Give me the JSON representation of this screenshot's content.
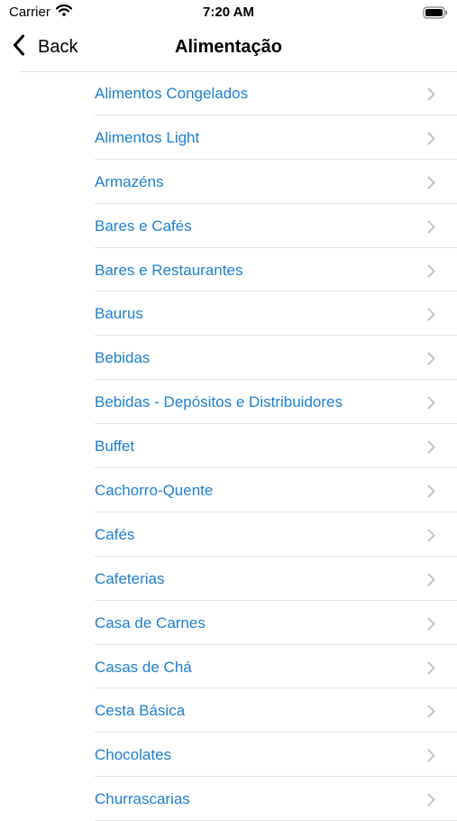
{
  "status": {
    "carrier": "Carrier",
    "time": "7:20 AM"
  },
  "nav": {
    "back_label": "Back",
    "title": "Alimentação"
  },
  "icons": {
    "back": "chevron-left-icon",
    "row": "chevron-right-icon",
    "wifi": "wifi-icon",
    "battery": "battery-icon"
  },
  "colors": {
    "link": "#1e7fd4",
    "separator": "#e4e4e4",
    "chevron": "#c4c4c6"
  },
  "items": [
    {
      "label": "Alimentos Congelados"
    },
    {
      "label": "Alimentos Light"
    },
    {
      "label": "Armazéns"
    },
    {
      "label": "Bares e Cafés"
    },
    {
      "label": "Bares e Restaurantes"
    },
    {
      "label": "Baurus"
    },
    {
      "label": "Bebidas"
    },
    {
      "label": "Bebidas - Depósitos e Distribuidores"
    },
    {
      "label": "Buffet"
    },
    {
      "label": "Cachorro-Quente"
    },
    {
      "label": "Cafés"
    },
    {
      "label": "Cafeterias"
    },
    {
      "label": "Casa de Carnes"
    },
    {
      "label": "Casas de Chá"
    },
    {
      "label": "Cesta Básica"
    },
    {
      "label": "Chocolates"
    },
    {
      "label": "Churrascarias"
    }
  ]
}
